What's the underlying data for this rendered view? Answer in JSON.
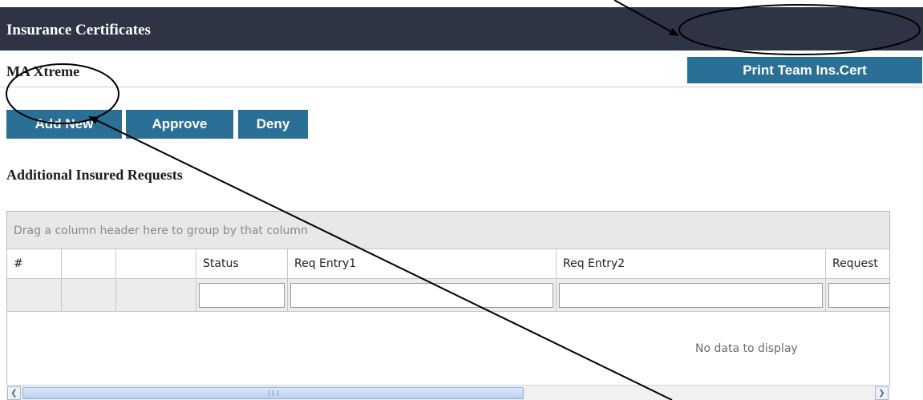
{
  "page": {
    "title": "Insurance Certificates",
    "team_name": "MA Xtreme"
  },
  "toolbar": {
    "print_label": "Print Team Ins.Cert",
    "add_new_label": "Add New",
    "approve_label": "Approve",
    "deny_label": "Deny"
  },
  "section": {
    "heading": "Additional Insured Requests"
  },
  "grid": {
    "group_panel_text": "Drag a column header here to group by that column",
    "columns": [
      "#",
      "",
      "",
      "Status",
      "Req Entry1",
      "Req Entry2",
      "Request"
    ],
    "empty_text": "No data to display",
    "scroll_grip": "III"
  },
  "colors": {
    "title_bar": "#2e3444",
    "button": "#2a6f95",
    "annotation": "#000000"
  },
  "icons": {
    "scroll_left": "scroll-left-arrow-icon",
    "scroll_right": "scroll-right-arrow-icon"
  }
}
